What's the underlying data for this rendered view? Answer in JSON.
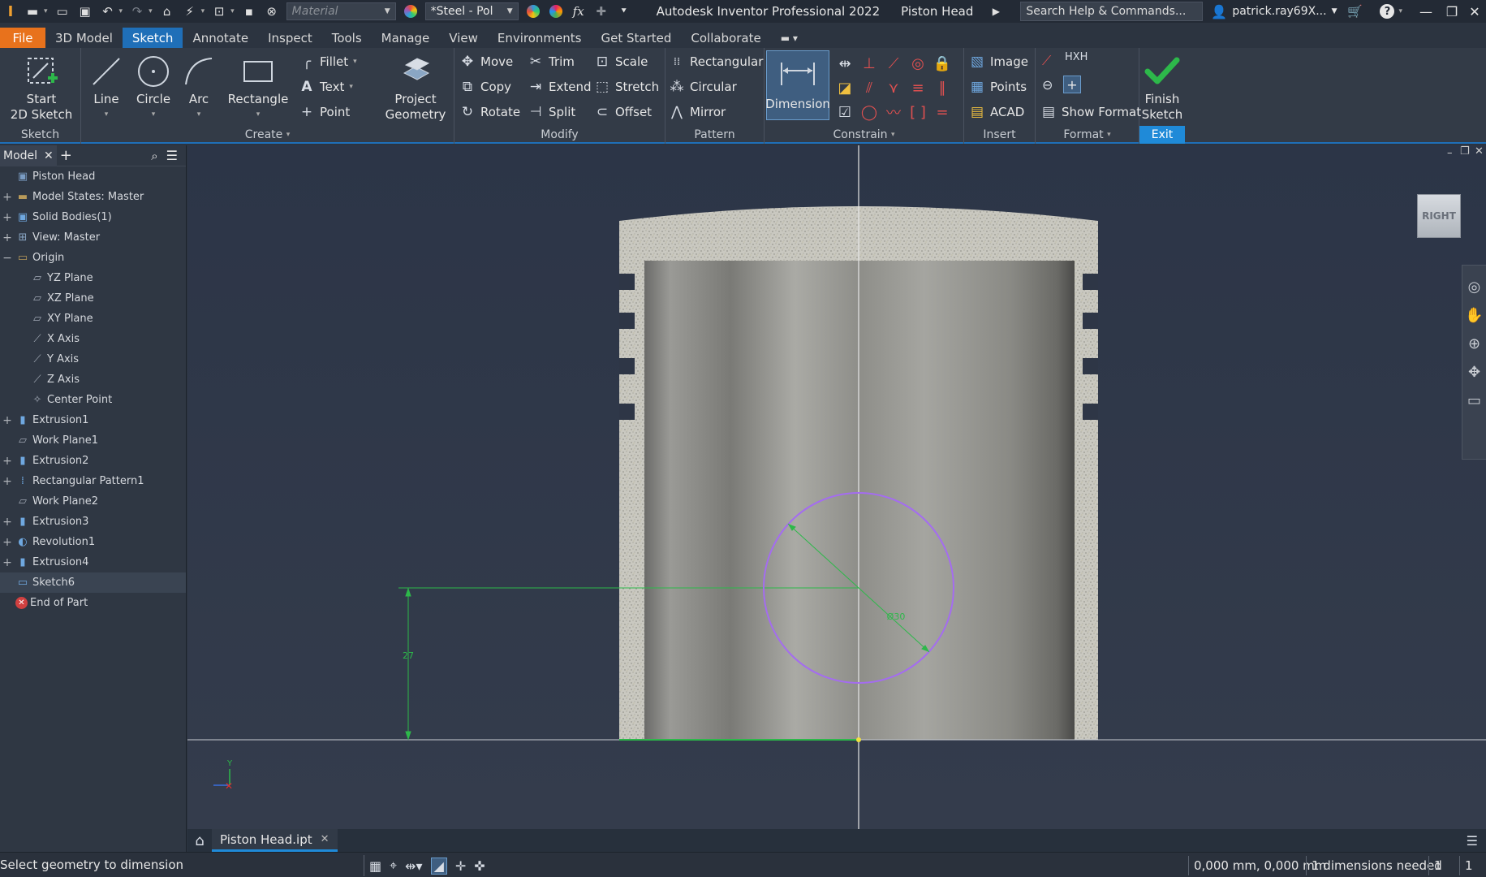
{
  "titlebar": {
    "material_placeholder": "Material",
    "appearance": "*Steel - Pol",
    "app_title": "Autodesk Inventor Professional 2022",
    "doc_title": "Piston Head",
    "search_placeholder": "Search Help & Commands...",
    "user": "patrick.ray69X..."
  },
  "menu": {
    "tabs": [
      "File",
      "3D Model",
      "Sketch",
      "Annotate",
      "Inspect",
      "Tools",
      "Manage",
      "View",
      "Environments",
      "Get Started",
      "Collaborate"
    ],
    "active": "Sketch"
  },
  "ribbon": {
    "sketch_panel": {
      "label": "Sketch",
      "start_line1": "Start",
      "start_line2": "2D Sketch"
    },
    "create_panel": {
      "label": "Create",
      "line": "Line",
      "circle": "Circle",
      "arc": "Arc",
      "rectangle": "Rectangle",
      "fillet": "Fillet",
      "text": "Text",
      "point": "Point",
      "project_line1": "Project",
      "project_line2": "Geometry"
    },
    "modify_panel": {
      "label": "Modify",
      "move": "Move",
      "copy": "Copy",
      "rotate": "Rotate",
      "trim": "Trim",
      "extend": "Extend",
      "split": "Split",
      "scale": "Scale",
      "stretch": "Stretch",
      "offset": "Offset"
    },
    "pattern_panel": {
      "label": "Pattern",
      "rectangular": "Rectangular",
      "circular": "Circular",
      "mirror": "Mirror"
    },
    "constrain_panel": {
      "label": "Constrain",
      "dimension": "Dimension"
    },
    "insert_panel": {
      "label": "Insert",
      "image": "Image",
      "points": "Points",
      "acad": "ACAD"
    },
    "format_panel": {
      "label": "Format",
      "show_format": "Show Format"
    },
    "exit_panel": {
      "label": "Exit",
      "finish_line1": "Finish",
      "finish_line2": "Sketch"
    }
  },
  "browser": {
    "tab": "Model",
    "items": [
      {
        "label": "Piston Head",
        "icon": "part-icon",
        "expander": "",
        "indent": 0
      },
      {
        "label": "Model States: Master",
        "icon": "folder-icon",
        "expander": "+",
        "indent": 0
      },
      {
        "label": "Solid Bodies(1)",
        "icon": "solid-bodies-icon",
        "expander": "+",
        "indent": 0
      },
      {
        "label": "View: Master",
        "icon": "view-icon",
        "expander": "+",
        "indent": 0
      },
      {
        "label": "Origin",
        "icon": "folder-open-icon",
        "expander": "−",
        "indent": 0
      },
      {
        "label": "YZ Plane",
        "icon": "plane-icon",
        "expander": "",
        "indent": 1
      },
      {
        "label": "XZ Plane",
        "icon": "plane-icon",
        "expander": "",
        "indent": 1
      },
      {
        "label": "XY Plane",
        "icon": "plane-icon",
        "expander": "",
        "indent": 1
      },
      {
        "label": "X Axis",
        "icon": "axis-icon",
        "expander": "",
        "indent": 1
      },
      {
        "label": "Y Axis",
        "icon": "axis-icon",
        "expander": "",
        "indent": 1
      },
      {
        "label": "Z Axis",
        "icon": "axis-icon",
        "expander": "",
        "indent": 1
      },
      {
        "label": "Center Point",
        "icon": "center-point-icon",
        "expander": "",
        "indent": 1
      },
      {
        "label": "Extrusion1",
        "icon": "extrusion-icon",
        "expander": "+",
        "indent": 0
      },
      {
        "label": "Work Plane1",
        "icon": "work-plane-icon",
        "expander": "",
        "indent": 0
      },
      {
        "label": "Extrusion2",
        "icon": "extrusion-icon",
        "expander": "+",
        "indent": 0
      },
      {
        "label": "Rectangular Pattern1",
        "icon": "rect-pattern-icon",
        "expander": "+",
        "indent": 0
      },
      {
        "label": "Work Plane2",
        "icon": "work-plane-icon",
        "expander": "",
        "indent": 0
      },
      {
        "label": "Extrusion3",
        "icon": "extrusion-icon",
        "expander": "+",
        "indent": 0
      },
      {
        "label": "Revolution1",
        "icon": "revolution-icon",
        "expander": "+",
        "indent": 0
      },
      {
        "label": "Extrusion4",
        "icon": "extrusion-icon",
        "expander": "+",
        "indent": 0
      },
      {
        "label": "Sketch6",
        "icon": "sketch-icon",
        "expander": "",
        "indent": 0,
        "selected": true
      },
      {
        "label": "End of Part",
        "icon": "end-of-part-icon",
        "expander": "",
        "indent": 0
      }
    ]
  },
  "viewport": {
    "viewcube_label": "RIGHT",
    "dim_vertical": "27",
    "dim_diameter": "Ø30",
    "triad_y": "Y"
  },
  "doctabs": {
    "file": "Piston Head.ipt"
  },
  "status": {
    "prompt": "Select geometry to dimension",
    "coords": "0,000 mm, 0,000 mm",
    "dims_needed": "1 dimensions needed",
    "count1": "1",
    "count2": "1"
  },
  "colors": {
    "accent": "#1f6fb8",
    "file_tab": "#e8721c",
    "sketch_circle": "#a46cf0",
    "dimension_green": "#2db84a"
  }
}
